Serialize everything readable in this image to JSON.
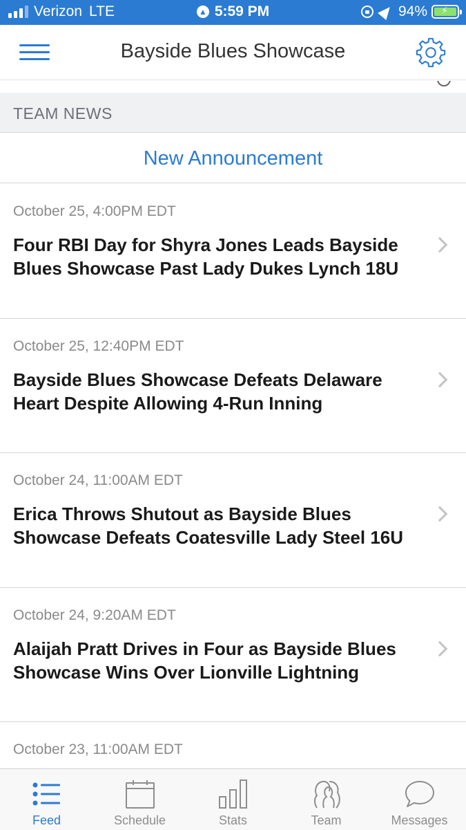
{
  "status_bar": {
    "carrier": "Verizon",
    "network": "LTE",
    "time": "5:59 PM",
    "battery": "94%"
  },
  "header": {
    "title": "Bayside Blues Showcase",
    "menu_icon": "hamburger-menu-icon",
    "settings_icon": "gear-icon"
  },
  "section": {
    "title": "TEAM NEWS",
    "new_announcement": "New Announcement"
  },
  "feed": [
    {
      "date": "October 25, 4:00PM EDT",
      "headline": "Four RBI Day for Shyra Jones Leads Bayside Blues Showcase Past Lady Dukes Lynch 18U"
    },
    {
      "date": "October 25, 12:40PM EDT",
      "headline": "Bayside Blues Showcase Defeats Delaware Heart Despite Allowing 4-Run Inning"
    },
    {
      "date": "October 24, 11:00AM EDT",
      "headline": "Erica Throws Shutout as Bayside Blues Showcase Defeats Coatesville Lady Steel 16U"
    },
    {
      "date": "October 24, 9:20AM EDT",
      "headline": "Alaijah Pratt Drives in Four as Bayside Blues Showcase Wins Over Lionville Lightning"
    },
    {
      "date": "October 23, 11:00AM EDT",
      "headline": ""
    }
  ],
  "tabs": [
    {
      "label": "Feed",
      "icon": "feed-list-icon",
      "active": true
    },
    {
      "label": "Schedule",
      "icon": "calendar-icon",
      "active": false
    },
    {
      "label": "Stats",
      "icon": "bar-chart-icon",
      "active": false
    },
    {
      "label": "Team",
      "icon": "team-people-icon",
      "active": false
    },
    {
      "label": "Messages",
      "icon": "chat-bubble-icon",
      "active": false
    }
  ],
  "colors": {
    "accent": "#2b7bd3",
    "section_bg": "#f0f1f3",
    "muted_text": "#8a8a8a"
  }
}
